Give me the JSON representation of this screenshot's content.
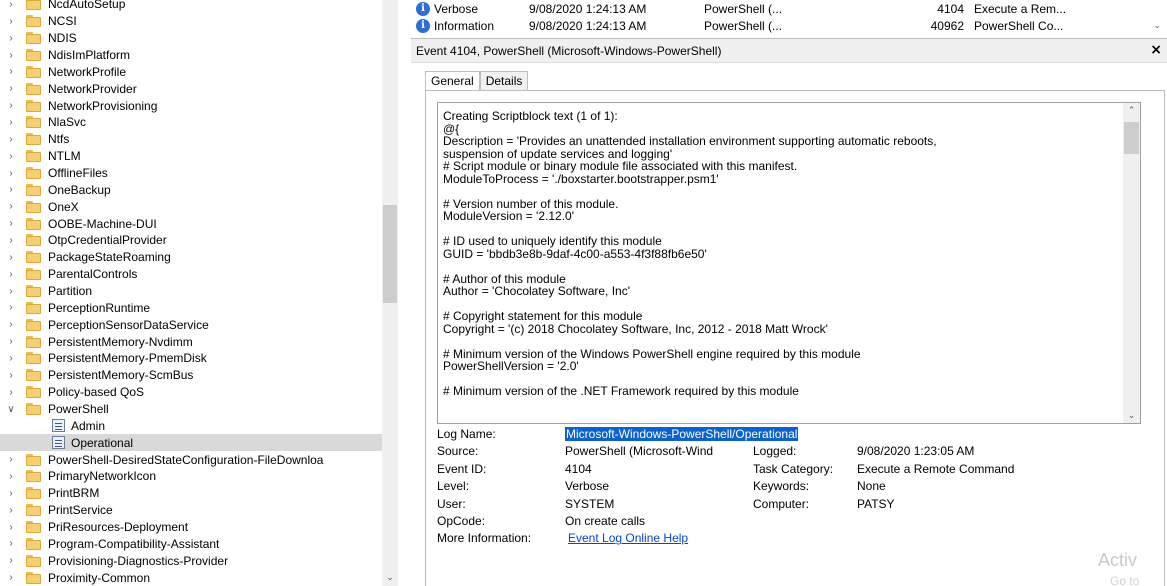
{
  "tree": {
    "items": [
      {
        "label": "NcdAutoSetup",
        "state": "collapsed"
      },
      {
        "label": "NCSI",
        "state": "collapsed"
      },
      {
        "label": "NDIS",
        "state": "collapsed"
      },
      {
        "label": "NdisImPlatform",
        "state": "collapsed"
      },
      {
        "label": "NetworkProfile",
        "state": "collapsed"
      },
      {
        "label": "NetworkProvider",
        "state": "collapsed"
      },
      {
        "label": "NetworkProvisioning",
        "state": "collapsed"
      },
      {
        "label": "NlaSvc",
        "state": "collapsed"
      },
      {
        "label": "Ntfs",
        "state": "collapsed"
      },
      {
        "label": "NTLM",
        "state": "collapsed"
      },
      {
        "label": "OfflineFiles",
        "state": "collapsed"
      },
      {
        "label": "OneBackup",
        "state": "collapsed"
      },
      {
        "label": "OneX",
        "state": "collapsed"
      },
      {
        "label": "OOBE-Machine-DUI",
        "state": "collapsed"
      },
      {
        "label": "OtpCredentialProvider",
        "state": "collapsed"
      },
      {
        "label": "PackageStateRoaming",
        "state": "collapsed"
      },
      {
        "label": "ParentalControls",
        "state": "collapsed"
      },
      {
        "label": "Partition",
        "state": "collapsed"
      },
      {
        "label": "PerceptionRuntime",
        "state": "collapsed"
      },
      {
        "label": "PerceptionSensorDataService",
        "state": "collapsed"
      },
      {
        "label": "PersistentMemory-Nvdimm",
        "state": "collapsed"
      },
      {
        "label": "PersistentMemory-PmemDisk",
        "state": "collapsed"
      },
      {
        "label": "PersistentMemory-ScmBus",
        "state": "collapsed"
      },
      {
        "label": "Policy-based QoS",
        "state": "collapsed"
      },
      {
        "label": "PowerShell",
        "state": "expanded"
      },
      {
        "label": "Admin",
        "state": "child"
      },
      {
        "label": "Operational",
        "state": "child-selected"
      },
      {
        "label": "PowerShell-DesiredStateConfiguration-FileDownloa",
        "state": "collapsed"
      },
      {
        "label": "PrimaryNetworkIcon",
        "state": "collapsed"
      },
      {
        "label": "PrintBRM",
        "state": "collapsed"
      },
      {
        "label": "PrintService",
        "state": "collapsed"
      },
      {
        "label": "PriResources-Deployment",
        "state": "collapsed"
      },
      {
        "label": "Program-Compatibility-Assistant",
        "state": "collapsed"
      },
      {
        "label": "Provisioning-Diagnostics-Provider",
        "state": "collapsed"
      },
      {
        "label": "Proximity-Common",
        "state": "collapsed"
      }
    ]
  },
  "events": {
    "rows": [
      {
        "level": "Verbose",
        "date": "9/08/2020 1:24:13 AM",
        "source": "PowerShell (...",
        "event_id": "4104",
        "task": "Execute a Rem..."
      },
      {
        "level": "Information",
        "date": "9/08/2020 1:24:13 AM",
        "source": "PowerShell (...",
        "event_id": "40962",
        "task": "PowerShell Co..."
      }
    ]
  },
  "event_pane": {
    "title": "Event 4104, PowerShell (Microsoft-Windows-PowerShell)",
    "close_glyph": "×",
    "tabs": [
      "General",
      "Details"
    ],
    "script_lines": [
      "Creating Scriptblock text (1 of 1):",
      "@{",
      "Description = 'Provides an unattended installation environment supporting automatic reboots,",
      "suspension of update services and logging'",
      "# Script module or binary module file associated with this manifest.",
      "ModuleToProcess = './boxstarter.bootstrapper.psm1'",
      "",
      "# Version number of this module.",
      "ModuleVersion = '2.12.0'",
      "",
      "# ID used to uniquely identify this module",
      "GUID = 'bbdb3e8b-9daf-4c00-a553-4f3f88fb6e50'",
      "",
      "# Author of this module",
      "Author = 'Chocolatey Software, Inc'",
      "",
      "# Copyright statement for this module",
      "Copyright = '(c) 2018 Chocolatey Software, Inc, 2012 - 2018 Matt Wrock'",
      "",
      "# Minimum version of the Windows PowerShell engine required by this module",
      "PowerShellVersion = '2.0'",
      "",
      "# Minimum version of the .NET Framework required by this module"
    ],
    "props": {
      "log_name_label": "Log Name:",
      "log_name": "Microsoft-Windows-PowerShell/Operational",
      "source_label": "Source:",
      "source": "PowerShell (Microsoft-Wind",
      "logged_label": "Logged:",
      "logged": "9/08/2020 1:23:05 AM",
      "event_id_label": "Event ID:",
      "event_id": "4104",
      "task_label": "Task Category:",
      "task": "Execute a Remote Command",
      "level_label": "Level:",
      "level": "Verbose",
      "keywords_label": "Keywords:",
      "keywords": "None",
      "user_label": "User:",
      "user": "SYSTEM",
      "computer_label": "Computer:",
      "computer": "PATSY",
      "opcode_label": "OpCode:",
      "opcode": "On create calls",
      "more_info_label": "More Information:",
      "more_info_link": "Event Log Online Help"
    }
  },
  "watermark": {
    "line1": "Activ",
    "line2": "Go to"
  }
}
